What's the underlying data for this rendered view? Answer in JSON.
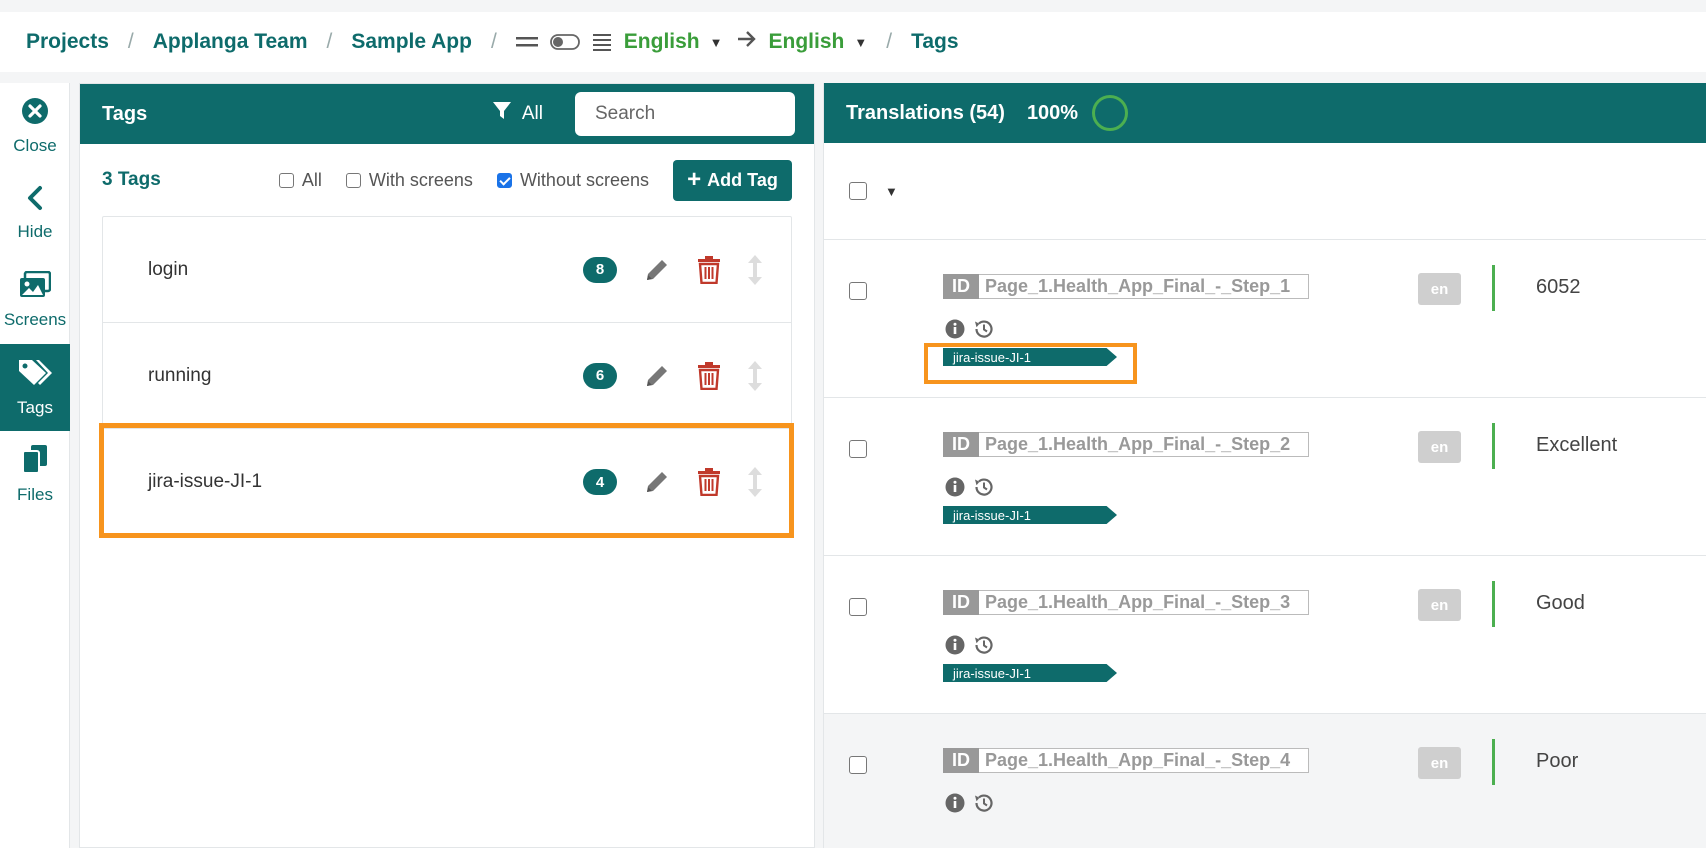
{
  "breadcrumb": {
    "projects": "Projects",
    "team": "Applanga Team",
    "app": "Sample App",
    "source_lang": "English",
    "target_lang": "English",
    "current": "Tags",
    "separator": "/"
  },
  "nav": [
    {
      "label": "Close",
      "icon": "close-circle-icon"
    },
    {
      "label": "Hide",
      "icon": "chevron-left-icon"
    },
    {
      "label": "Screens",
      "icon": "images-icon"
    },
    {
      "label": "Tags",
      "icon": "tags-icon",
      "active": true
    },
    {
      "label": "Files",
      "icon": "files-icon"
    }
  ],
  "tags_panel": {
    "title": "Tags",
    "filter_label": "All",
    "search_placeholder": "Search",
    "count_label": "3 Tags",
    "checkbox_all": "All",
    "checkbox_with_screens": "With screens",
    "checkbox_without_screens": "Without screens",
    "without_screens_checked": true,
    "add_tag_label": "Add Tag",
    "tags": [
      {
        "name": "login",
        "count": "8"
      },
      {
        "name": "running",
        "count": "6"
      },
      {
        "name": "jira-issue-JI-1",
        "count": "4",
        "highlighted": true
      }
    ]
  },
  "translations_panel": {
    "title": "Translations (54)",
    "percent": "100%",
    "rows": [
      {
        "id_tag": "ID",
        "id": "Page_1.Health_App_Final_-_Step_1",
        "lang": "en",
        "value": "6052",
        "tag": "jira-issue-JI-1"
      },
      {
        "id_tag": "ID",
        "id": "Page_1.Health_App_Final_-_Step_2",
        "lang": "en",
        "value": "Excellent",
        "tag": "jira-issue-JI-1"
      },
      {
        "id_tag": "ID",
        "id": "Page_1.Health_App_Final_-_Step_3",
        "lang": "en",
        "value": "Good",
        "tag": "jira-issue-JI-1"
      },
      {
        "id_tag": "ID",
        "id": "Page_1.Health_App_Final_-_Step_4",
        "lang": "en",
        "value": "Poor",
        "tag": ""
      }
    ]
  },
  "colors": {
    "brand_teal": "#0e6b6b",
    "lang_green": "#3a9d3a",
    "delete_red": "#c0392b",
    "highlight_orange": "#f7941d"
  }
}
